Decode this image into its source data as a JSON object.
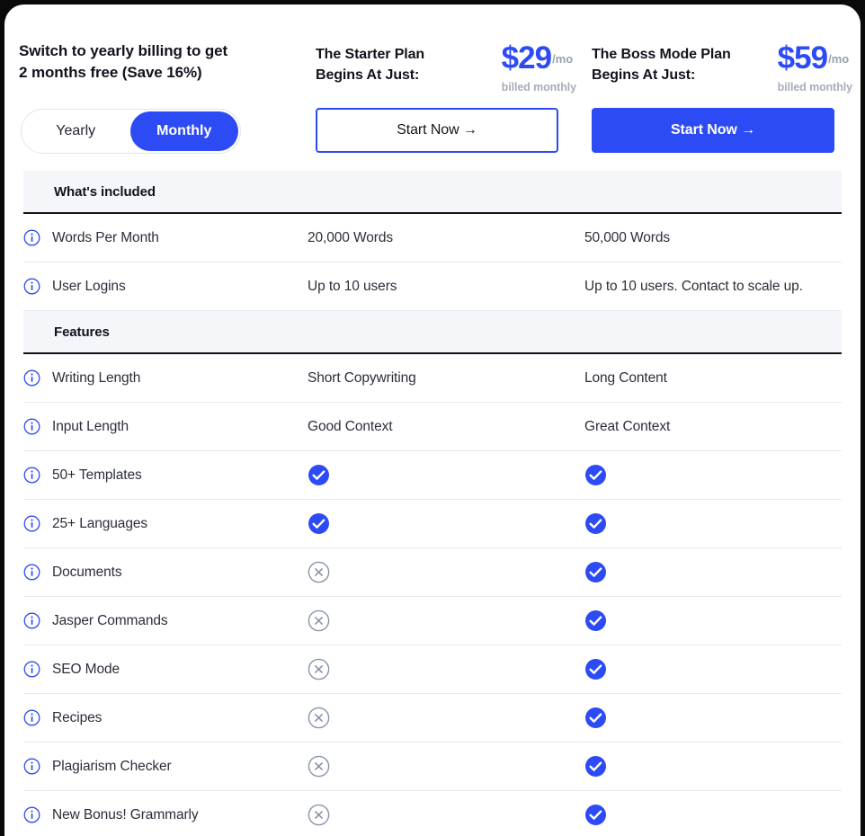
{
  "promo": {
    "line1": "Switch to yearly billing to get",
    "line2": "2 months free (Save 16%)"
  },
  "billing_toggle": {
    "yearly_label": "Yearly",
    "monthly_label": "Monthly",
    "selected": "Monthly"
  },
  "plans": [
    {
      "key": "starter",
      "title_line1": "The Starter Plan",
      "title_line2": "Begins At Just:",
      "price": "$29",
      "per": "/mo",
      "billed": "billed monthly",
      "cta_label": "Start Now →",
      "cta_style": "outline"
    },
    {
      "key": "boss",
      "title_line1": "The Boss Mode Plan",
      "title_line2": "Begins At Just:",
      "price": "$59",
      "per": "/mo",
      "billed": "billed monthly",
      "cta_label": "Start Now →",
      "cta_style": "filled"
    }
  ],
  "sections": [
    {
      "heading": "What's included",
      "rows": [
        {
          "label": "Words Per Month",
          "starter": "20,000 Words",
          "boss": "50,000 Words",
          "type": "text"
        },
        {
          "label": "User Logins",
          "starter": "Up to 10 users",
          "boss": "Up to 10 users. Contact to scale up.",
          "type": "text"
        }
      ]
    },
    {
      "heading": "Features",
      "rows": [
        {
          "label": "Writing Length",
          "starter": "Short Copywriting",
          "boss": "Long Content",
          "type": "text"
        },
        {
          "label": "Input Length",
          "starter": "Good Context",
          "boss": "Great Context",
          "type": "text"
        },
        {
          "label": "50+ Templates",
          "starter": "check",
          "boss": "check",
          "type": "mark"
        },
        {
          "label": "25+ Languages",
          "starter": "check",
          "boss": "check",
          "type": "mark"
        },
        {
          "label": "Documents",
          "starter": "cross",
          "boss": "check",
          "type": "mark"
        },
        {
          "label": "Jasper Commands",
          "starter": "cross",
          "boss": "check",
          "type": "mark"
        },
        {
          "label": "SEO Mode",
          "starter": "cross",
          "boss": "check",
          "type": "mark"
        },
        {
          "label": "Recipes",
          "starter": "cross",
          "boss": "check",
          "type": "mark"
        },
        {
          "label": "Plagiarism Checker",
          "starter": "cross",
          "boss": "check",
          "type": "mark"
        },
        {
          "label": "New Bonus! Grammarly",
          "starter": "cross",
          "boss": "check",
          "type": "mark"
        }
      ]
    }
  ],
  "icons": {
    "info": "info-icon",
    "check": "check-circle-filled-icon",
    "cross": "cross-circle-outline-icon"
  },
  "colors": {
    "accent_blue": "#2d4bf5",
    "text_dark": "#11131c",
    "muted_gray": "#a7adb9",
    "cross_gray": "#8a93a6",
    "band_bg": "#f4f6fa",
    "row_border": "#e7eaf0",
    "page_bg": "#0a0a0a"
  }
}
